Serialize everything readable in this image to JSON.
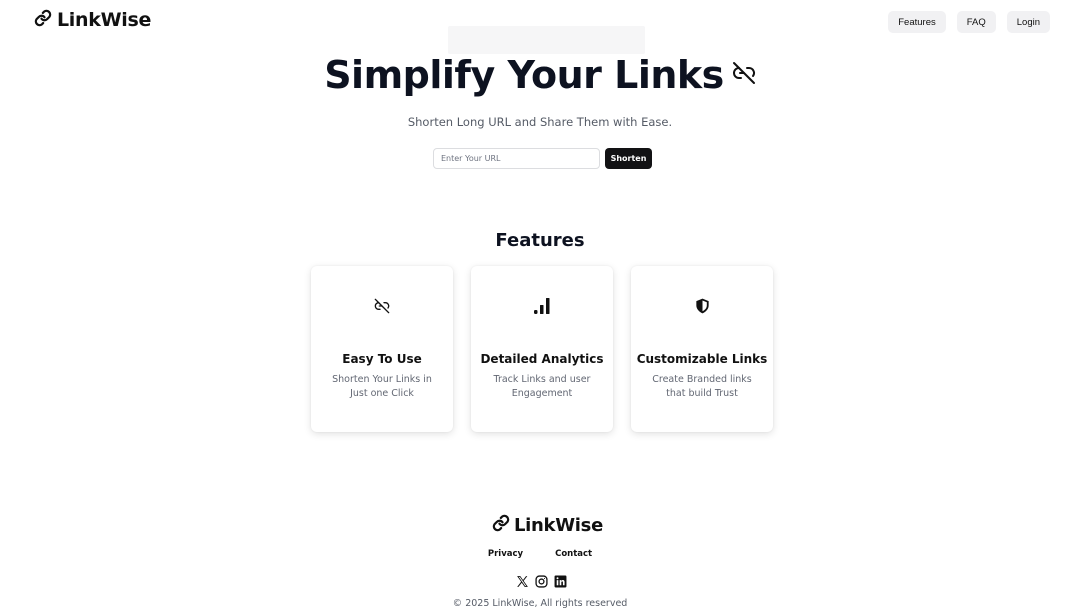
{
  "brand": {
    "name": "LinkWise"
  },
  "nav": {
    "features": "Features",
    "faq": "FAQ",
    "login": "Login"
  },
  "hero": {
    "title": "Simplify Your Links",
    "subtitle": "Shorten Long URL and Share Them with Ease.",
    "input_placeholder": "Enter Your URL",
    "input_value": "",
    "button": "Shorten"
  },
  "features": {
    "title": "Features",
    "cards": [
      {
        "icon": "broken-link-icon",
        "title": "Easy To Use",
        "desc": "Shorten Your Links in Just one Click"
      },
      {
        "icon": "signal-bars-icon",
        "title": "Detailed Analytics",
        "desc": "Track Links and user Engagement"
      },
      {
        "icon": "shield-icon",
        "title": "Customizable Links",
        "desc": "Create Branded links that build Trust"
      }
    ]
  },
  "footer": {
    "brand": "LinkWise",
    "links": {
      "privacy": "Privacy",
      "contact": "Contact"
    },
    "socials": [
      "x-icon",
      "instagram-icon",
      "linkedin-icon"
    ],
    "copyright": "© 2025 LinkWise, All rights reserved"
  },
  "colors": {
    "primary_button": "#121214",
    "nav_button_bg": "#f1f1f3",
    "muted_text": "#555b66"
  }
}
